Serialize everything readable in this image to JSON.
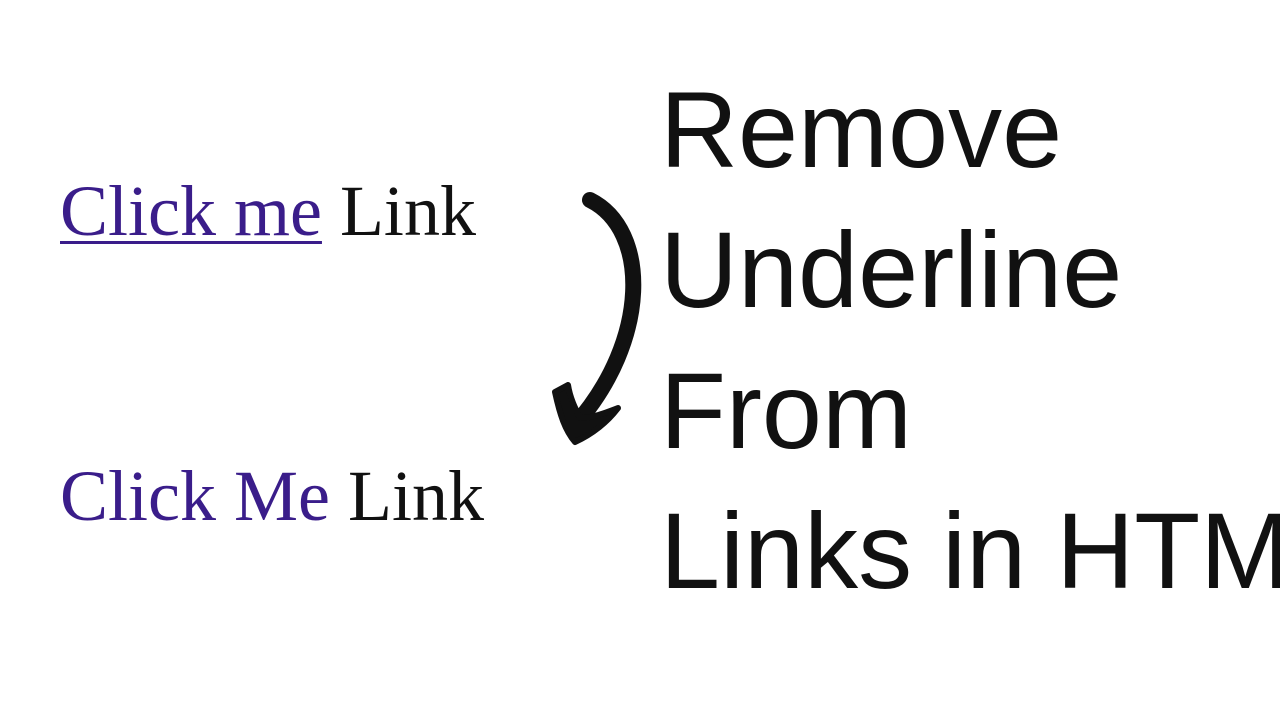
{
  "examples": {
    "before": {
      "link_text": "Click me",
      "label_text": " Link"
    },
    "after": {
      "link_text": "Click Me",
      "label_text": " Link"
    }
  },
  "title": {
    "line1": "Remove",
    "line2": "Underline",
    "line3": "From",
    "line4": "Links in HTML"
  },
  "colors": {
    "link": "#3a1d8a",
    "text": "#111111",
    "background": "#ffffff"
  }
}
